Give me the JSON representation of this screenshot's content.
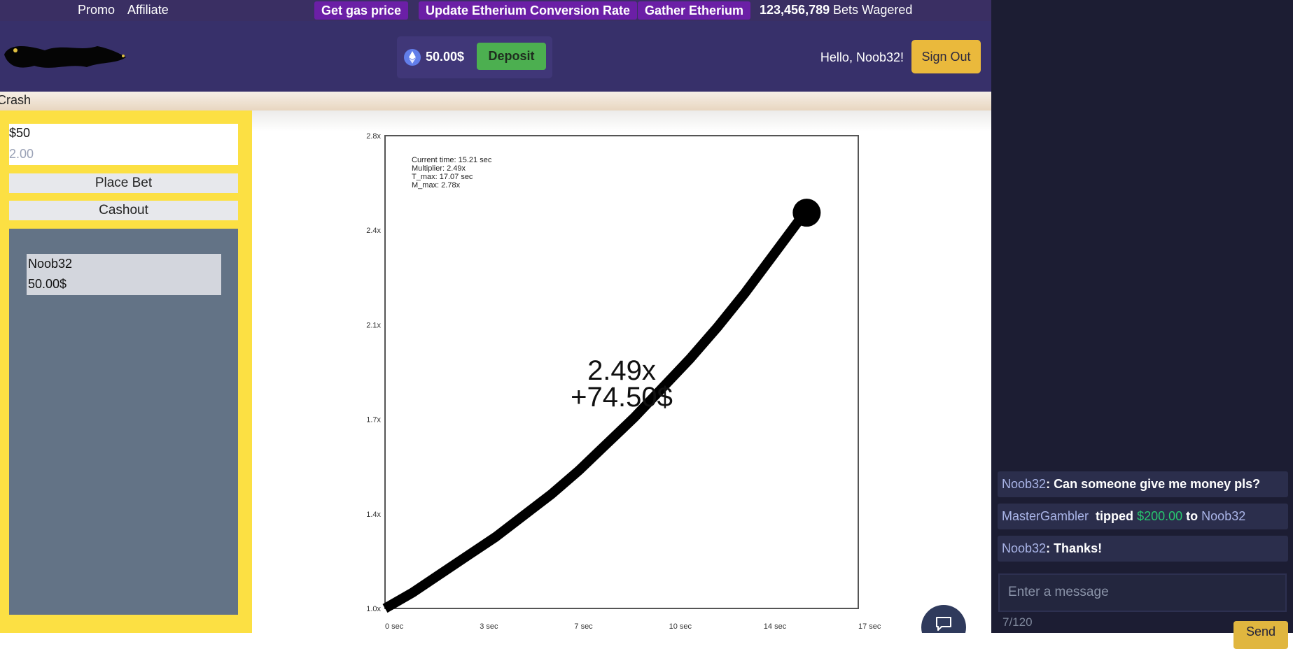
{
  "topnav": {
    "promo": "Promo",
    "affiliate": "Affiliate",
    "gas": "Get gas price",
    "update_rate": "Update Etherium Conversion Rate",
    "gather": "Gather Etherium",
    "wagered_count": "123,456,789",
    "wagered_label": "Bets Wagered",
    "pill_color": "#6b1fa6"
  },
  "header": {
    "balance": "50.00$",
    "deposit": "Deposit",
    "greeting": "Hello, Noob32!",
    "sign_out": "Sign Out",
    "bg_color": "#37306a"
  },
  "breadcrumb": "Crash",
  "bet_panel": {
    "amount": "$50",
    "multiplier_placeholder": "2.00",
    "place_bet": "Place Bet",
    "cashout": "Cashout"
  },
  "players": [
    {
      "name": "Noob32",
      "amount": "50.00$"
    }
  ],
  "game": {
    "multiplier": "2.49x",
    "profit": "+74.50$",
    "info": {
      "current_time": "Current time: 15.21 sec",
      "multiplier": "Multiplier: 2.49x",
      "t_max": "T_max: 17.07 sec",
      "m_max": "M_max: 2.78x"
    }
  },
  "chart_data": {
    "type": "line",
    "title": "",
    "xlabel": "",
    "ylabel": "",
    "xlim": [
      0,
      17.07
    ],
    "ylim": [
      1.0,
      2.78
    ],
    "x_ticks": [
      "0 sec",
      "3 sec",
      "7 sec",
      "10 sec",
      "14 sec",
      "17 sec"
    ],
    "y_ticks": [
      "1.0x",
      "1.4x",
      "1.7x",
      "2.1x",
      "2.4x",
      "2.8x"
    ],
    "grid": false,
    "series": [
      {
        "x": [
          0,
          1,
          2,
          3,
          4,
          5,
          6,
          7,
          8,
          9,
          10,
          11,
          12,
          13,
          14,
          15,
          15.21
        ],
        "values": [
          1.0,
          1.06,
          1.13,
          1.2,
          1.27,
          1.35,
          1.43,
          1.52,
          1.62,
          1.72,
          1.83,
          1.94,
          2.06,
          2.19,
          2.33,
          2.47,
          2.49
        ]
      }
    ]
  },
  "chat": {
    "messages": [
      {
        "user": "Noob32",
        "text": "Can someone give me money pls?"
      },
      {
        "tipper": "MasterGambler",
        "tipped": "tipped",
        "amount": "$200.00",
        "to": "to",
        "recipient": "Noob32"
      },
      {
        "user": "Noob32",
        "text": "Thanks!"
      }
    ],
    "input_placeholder": "Enter a message",
    "counter": "7/120",
    "send": "Send"
  }
}
